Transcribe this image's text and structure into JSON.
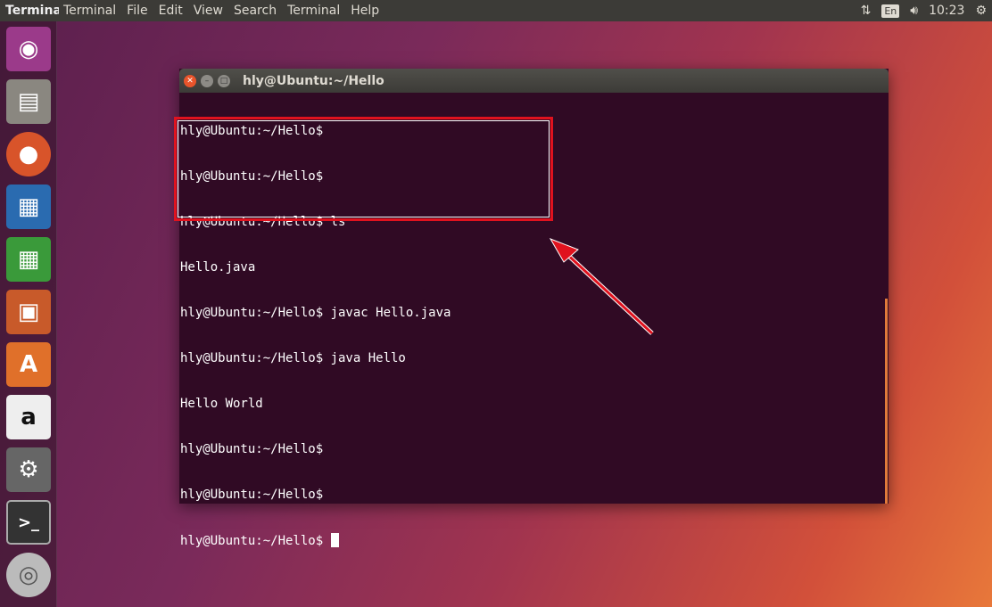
{
  "topbar": {
    "app_name": "Terminal",
    "menus": [
      "Terminal",
      "File",
      "Edit",
      "View",
      "Search",
      "Terminal",
      "Help"
    ],
    "keyboard": "En",
    "time": "10:23"
  },
  "launcher": [
    {
      "name": "ubuntu-dash"
    },
    {
      "name": "files"
    },
    {
      "name": "firefox"
    },
    {
      "name": "libreoffice-writer"
    },
    {
      "name": "libreoffice-calc"
    },
    {
      "name": "libreoffice-impress"
    },
    {
      "name": "ubuntu-software"
    },
    {
      "name": "amazon"
    },
    {
      "name": "system-settings"
    },
    {
      "name": "terminal"
    },
    {
      "name": "dvd"
    }
  ],
  "terminal": {
    "title": "hly@Ubuntu:~/Hello",
    "lines": [
      "hly@Ubuntu:~/Hello$",
      "hly@Ubuntu:~/Hello$",
      "hly@Ubuntu:~/Hello$ ls",
      "Hello.java",
      "hly@Ubuntu:~/Hello$ javac Hello.java",
      "hly@Ubuntu:~/Hello$ java Hello",
      "Hello World",
      "hly@Ubuntu:~/Hello$",
      "hly@Ubuntu:~/Hello$",
      "hly@Ubuntu:~/Hello$ "
    ]
  },
  "colors": {
    "terminal_bg": "#300a24",
    "highlight": "#e0121e",
    "arrow": "#e0121e"
  }
}
